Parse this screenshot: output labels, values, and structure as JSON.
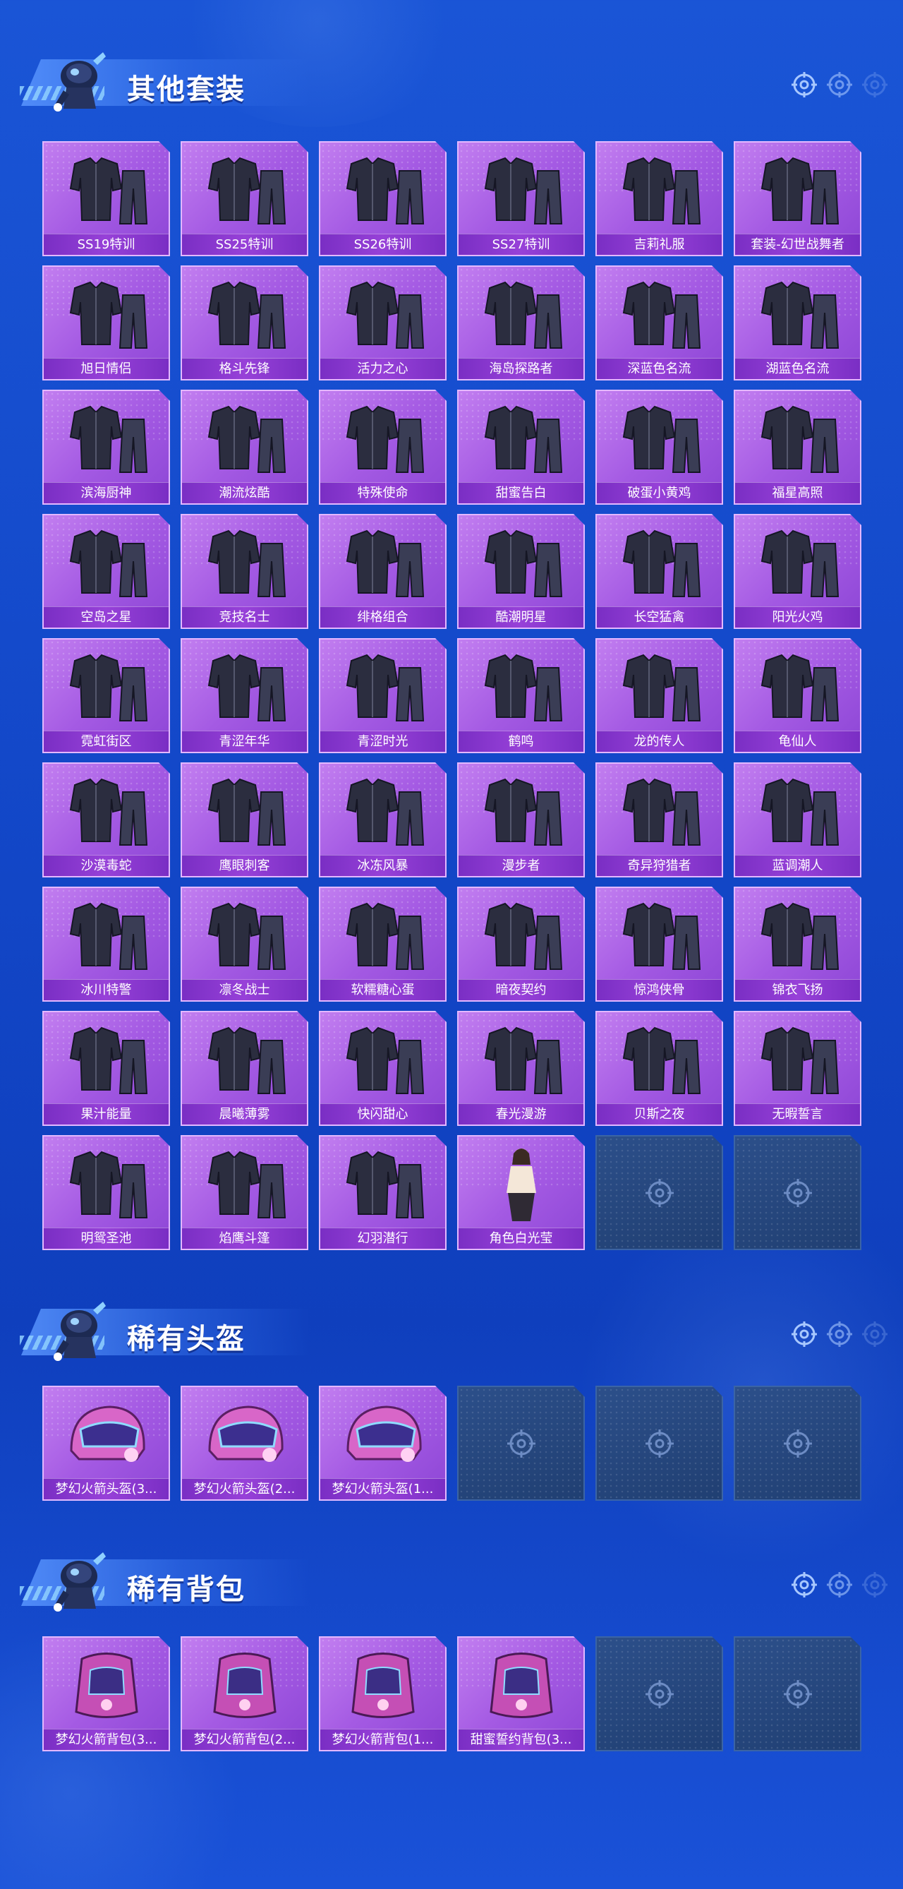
{
  "sections": {
    "outfits": {
      "title": "其他套装",
      "items": [
        {
          "label": "SS19特训",
          "icon": "outfit-icon"
        },
        {
          "label": "SS25特训",
          "icon": "outfit-icon"
        },
        {
          "label": "SS26特训",
          "icon": "outfit-icon"
        },
        {
          "label": "SS27特训",
          "icon": "outfit-icon"
        },
        {
          "label": "吉莉礼服",
          "icon": "outfit-icon"
        },
        {
          "label": "套装-幻世战舞者",
          "icon": "outfit-icon"
        },
        {
          "label": "旭日情侣",
          "icon": "outfit-icon"
        },
        {
          "label": "格斗先锋",
          "icon": "outfit-icon"
        },
        {
          "label": "活力之心",
          "icon": "outfit-icon"
        },
        {
          "label": "海岛探路者",
          "icon": "outfit-icon"
        },
        {
          "label": "深蓝色名流",
          "icon": "outfit-icon"
        },
        {
          "label": "湖蓝色名流",
          "icon": "outfit-icon"
        },
        {
          "label": "滨海厨神",
          "icon": "outfit-icon"
        },
        {
          "label": "潮流炫酷",
          "icon": "outfit-icon"
        },
        {
          "label": "特殊使命",
          "icon": "outfit-icon"
        },
        {
          "label": "甜蜜告白",
          "icon": "outfit-icon"
        },
        {
          "label": "破蛋小黄鸡",
          "icon": "outfit-icon"
        },
        {
          "label": "福星高照",
          "icon": "outfit-icon"
        },
        {
          "label": "空岛之星",
          "icon": "outfit-icon"
        },
        {
          "label": "竞技名士",
          "icon": "outfit-icon"
        },
        {
          "label": "绯格组合",
          "icon": "outfit-icon"
        },
        {
          "label": "酷潮明星",
          "icon": "outfit-icon"
        },
        {
          "label": "长空猛禽",
          "icon": "outfit-icon"
        },
        {
          "label": "阳光火鸡",
          "icon": "outfit-icon"
        },
        {
          "label": "霓虹街区",
          "icon": "outfit-icon"
        },
        {
          "label": "青涩年华",
          "icon": "outfit-icon"
        },
        {
          "label": "青涩时光",
          "icon": "outfit-icon"
        },
        {
          "label": "鹤鸣",
          "icon": "outfit-icon"
        },
        {
          "label": "龙的传人",
          "icon": "outfit-icon"
        },
        {
          "label": "龟仙人",
          "icon": "outfit-icon"
        },
        {
          "label": "沙漠毒蛇",
          "icon": "outfit-icon"
        },
        {
          "label": "鹰眼刺客",
          "icon": "outfit-icon"
        },
        {
          "label": "冰冻风暴",
          "icon": "outfit-icon"
        },
        {
          "label": "漫步者",
          "icon": "outfit-icon"
        },
        {
          "label": "奇异狩猎者",
          "icon": "outfit-icon"
        },
        {
          "label": "蓝调潮人",
          "icon": "outfit-icon"
        },
        {
          "label": "冰川特警",
          "icon": "outfit-icon"
        },
        {
          "label": "凛冬战士",
          "icon": "outfit-icon"
        },
        {
          "label": "软糯糖心蛋",
          "icon": "outfit-icon"
        },
        {
          "label": "暗夜契约",
          "icon": "outfit-icon"
        },
        {
          "label": "惊鸿侠骨",
          "icon": "outfit-icon"
        },
        {
          "label": "锦衣飞扬",
          "icon": "outfit-icon"
        },
        {
          "label": "果汁能量",
          "icon": "outfit-icon"
        },
        {
          "label": "晨曦薄雾",
          "icon": "outfit-icon"
        },
        {
          "label": "快闪甜心",
          "icon": "outfit-icon"
        },
        {
          "label": "春光漫游",
          "icon": "outfit-icon"
        },
        {
          "label": "贝斯之夜",
          "icon": "outfit-icon"
        },
        {
          "label": "无暇誓言",
          "icon": "outfit-icon"
        },
        {
          "label": "明鸳圣池",
          "icon": "outfit-icon"
        },
        {
          "label": "焰鹰斗篷",
          "icon": "outfit-icon"
        },
        {
          "label": "幻羽潜行",
          "icon": "outfit-icon"
        },
        {
          "label": "角色白光莹",
          "icon": "character-icon"
        }
      ],
      "empty_slots": 2
    },
    "helmets": {
      "title": "稀有头盔",
      "items": [
        {
          "label": "梦幻火箭头盔(3...",
          "icon": "helmet-icon"
        },
        {
          "label": "梦幻火箭头盔(2...",
          "icon": "helmet-icon"
        },
        {
          "label": "梦幻火箭头盔(1...",
          "icon": "helmet-icon"
        }
      ],
      "empty_slots": 3
    },
    "backpacks": {
      "title": "稀有背包",
      "items": [
        {
          "label": "梦幻火箭背包(3...",
          "icon": "backpack-icon"
        },
        {
          "label": "梦幻火箭背包(2...",
          "icon": "backpack-icon"
        },
        {
          "label": "梦幻火箭背包(1...",
          "icon": "backpack-icon"
        },
        {
          "label": "甜蜜誓约背包(3...",
          "icon": "backpack-icon"
        }
      ],
      "empty_slots": 2
    }
  },
  "colors": {
    "background": "#1348c9",
    "card_purple": "#a45ae3",
    "card_label": "#7a2ec4",
    "empty_slot": "#203f72"
  }
}
